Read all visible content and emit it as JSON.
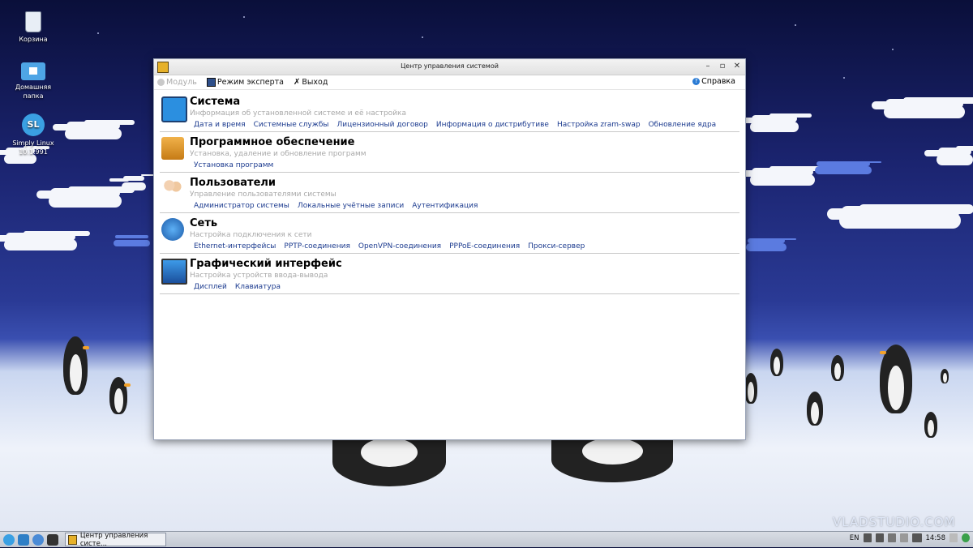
{
  "desktop": {
    "icons": [
      {
        "label": "Корзина"
      },
      {
        "label": "Домашняя папка"
      },
      {
        "label": "Simply Linux 10.1.991"
      }
    ],
    "watermark": "VLADSTUDIO.COM"
  },
  "window": {
    "title": "Центр управления системой",
    "toolbar": {
      "module": "Модуль",
      "expert": "Режим эксперта",
      "exit": "Выход",
      "help": "Справка"
    },
    "sections": [
      {
        "title": "Система",
        "desc": "Информация об установленной системе и её настройка",
        "icon": "system-monitor-icon",
        "links": [
          "Дата и время",
          "Системные службы",
          "Лицензионный договор",
          "Информация о дистрибутиве",
          "Настройка zram-swap",
          "Обновление ядра"
        ]
      },
      {
        "title": "Программное обеспечение",
        "desc": "Установка, удаление и обновление программ",
        "icon": "package-box-icon",
        "links": [
          "Установка программ"
        ]
      },
      {
        "title": "Пользователи",
        "desc": "Управление пользователями системы",
        "icon": "users-icon",
        "links": [
          "Администратор системы",
          "Локальные учётные записи",
          "Аутентификация"
        ]
      },
      {
        "title": "Сеть",
        "desc": "Настройка подключения к сети",
        "icon": "network-globe-icon",
        "links": [
          "Ethernet-интерфейсы",
          "PPTP-соединения",
          "OpenVPN-соединения",
          "PPPoE-соединения",
          "Прокси-сервер"
        ]
      },
      {
        "title": "Графический интерфейс",
        "desc": "Настройка устройств ввода-вывода",
        "icon": "display-icon",
        "links": [
          "Дисплей",
          "Клавиатура"
        ]
      }
    ]
  },
  "taskbar": {
    "task": "Центр управления систе...",
    "lang": "EN",
    "time": "14:58"
  }
}
